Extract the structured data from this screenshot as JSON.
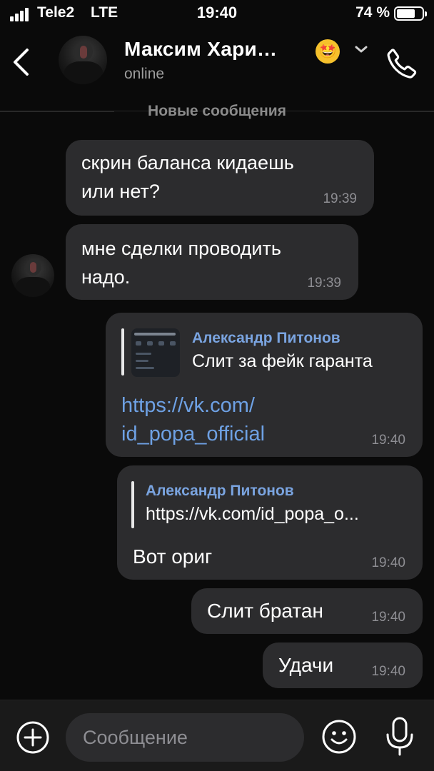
{
  "status_bar": {
    "carrier": "Tele2",
    "network": "LTE",
    "time": "19:40",
    "battery": "74 %",
    "battery_level": 0.74
  },
  "header": {
    "name": "Максим Хари…",
    "status": "online",
    "emoji": "🤩"
  },
  "divider": {
    "label": "Новые сообщения"
  },
  "messages": [
    {
      "direction": "incoming",
      "text_lines": [
        "скрин баланса кидаешь",
        "или нет?"
      ],
      "time": "19:39"
    },
    {
      "direction": "incoming",
      "text_lines": [
        "мне сделки проводить",
        "надо."
      ],
      "time": "19:39"
    },
    {
      "direction": "outgoing",
      "reply": {
        "author": "Александр Питонов",
        "text": "Слит за фейк гаранта",
        "has_thumbnail": true
      },
      "link_lines": [
        "https://vk.com/",
        "id_popa_official"
      ],
      "time": "19:40"
    },
    {
      "direction": "outgoing",
      "reply": {
        "author": "Александр Питонов",
        "text": "https://vk.com/id_popa_o..."
      },
      "text": "Вот ориг",
      "time": "19:40"
    },
    {
      "direction": "outgoing",
      "text": "Слит братан",
      "time": "19:40"
    },
    {
      "direction": "outgoing",
      "text": "Удачи",
      "time": "19:40"
    }
  ],
  "composer": {
    "placeholder": "Сообщение"
  },
  "colors": {
    "background": "#0a0a0a",
    "bubble": "#2c2c2e",
    "link": "#6ea1e4",
    "reply_author": "#7aa4e0",
    "timestamp": "#8e8e93"
  }
}
